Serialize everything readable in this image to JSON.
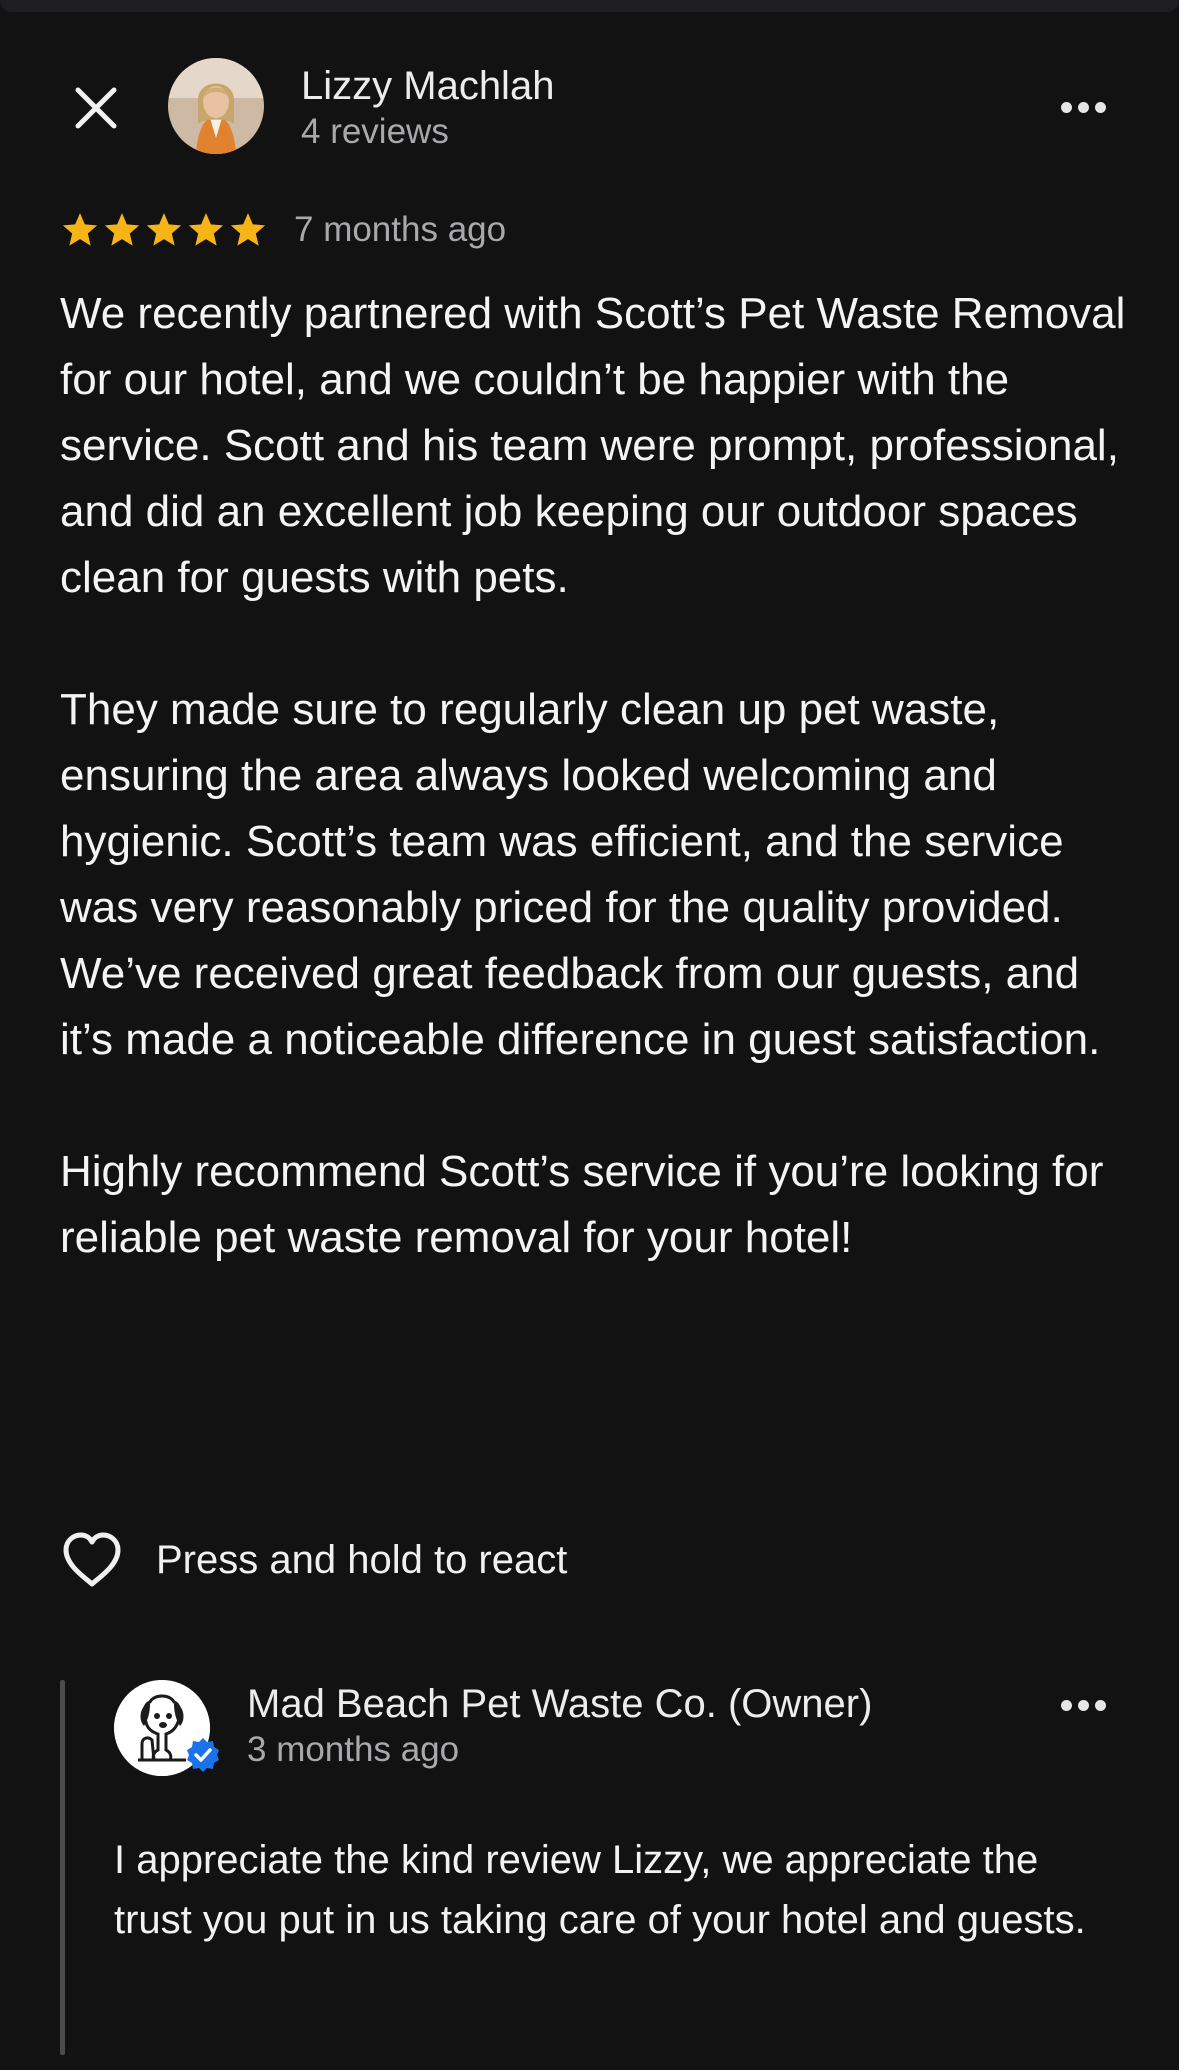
{
  "review": {
    "reviewer_name": "Lizzy Machlah",
    "reviewer_meta": "4 reviews",
    "rating": 5,
    "max_rating": 5,
    "date": "7 months ago",
    "paragraphs": [
      "We recently partnered with Scott’s Pet Waste Removal for our hotel, and we couldn’t be happier with the service. Scott and his team were prompt, professional, and did an excellent job keeping our outdoor spaces clean for guests with pets.",
      "They made sure to regularly clean up pet waste, ensuring the area always looked welcoming and hygienic. Scott’s team was efficient, and the service was very reasonably priced for the quality provided. We’ve received great feedback from our guests, and it’s made a noticeable difference in guest satisfaction.",
      "Highly recommend Scott’s service if you’re looking for reliable pet waste removal for your hotel!"
    ]
  },
  "reaction": {
    "label": "Press and hold to react",
    "icon": "heart-outline-icon"
  },
  "owner_reply": {
    "name": "Mad Beach Pet Waste Co. (Owner)",
    "date": "3 months ago",
    "text": "I appreciate the kind review Lizzy, we appreciate the trust you put in us taking care of your hotel and guests."
  },
  "icons": {
    "close": "close-icon",
    "more": "more-options-icon",
    "star": "star-icon",
    "verified": "verified-badge-icon"
  },
  "colors": {
    "background": "#121213",
    "star": "#f6b416",
    "verified": "#1a73e8",
    "muted_text": "#a9a9ac"
  }
}
